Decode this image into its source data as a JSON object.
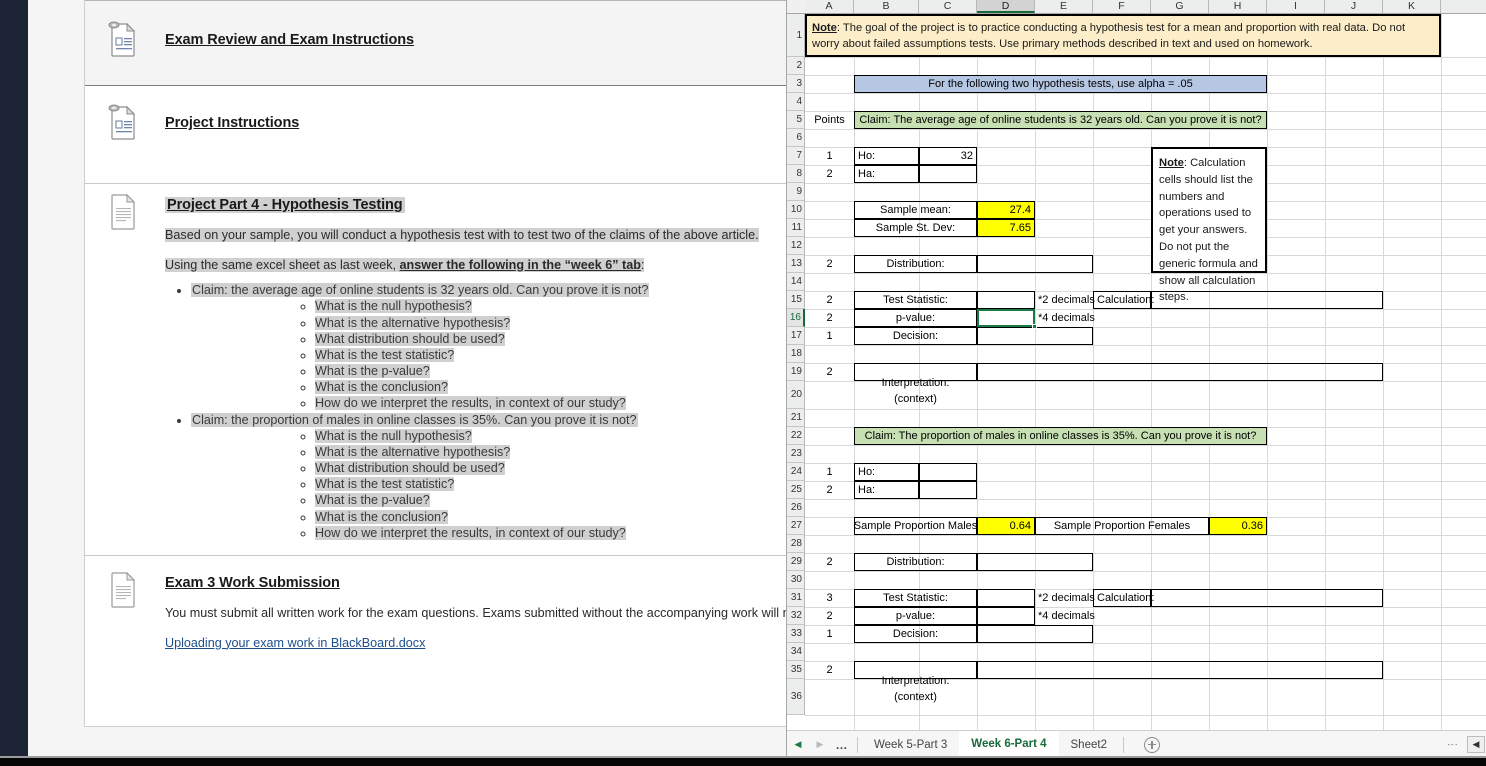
{
  "lms": {
    "items": [
      {
        "id": "exam-review",
        "icon": "document-attachment-icon",
        "title": "Exam Review and Exam Instructions",
        "selected": true
      },
      {
        "id": "project-instructions",
        "icon": "document-attachment-icon",
        "title": "Project Instructions",
        "selected": false
      },
      {
        "id": "project-part-4",
        "icon": "document-icon",
        "title": "Project Part 4 - Hypothesis Testing",
        "paragraphs": [
          "Based on your sample, you will conduct a hypothesis test with  to test two of the claims of the above article.",
          "Using the same excel sheet as last week, "
        ],
        "paragraph2_bold": "answer the following in the “week 6” tab",
        "paragraph2_tail": ":",
        "bullets": [
          {
            "text": "Claim: the average age of online students is 32 years old. Can you prove it is not?",
            "sub": [
              "What is the null hypothesis?",
              "What is the alternative hypothesis?",
              "What distribution should be used?",
              "What is the test statistic?",
              "What is the p-value?",
              "What is the conclusion?",
              "How do we interpret the results, in context of our study?"
            ]
          },
          {
            "text": "Claim: the proportion of males in online classes is 35%. Can you prove it is not?",
            "sub": [
              "What is the null hypothesis?",
              "What is the alternative hypothesis?",
              "What distribution should be used?",
              "What is the test statistic?",
              "What is the p-value?",
              "What is the conclusion?",
              "How do we interpret the results, in context of our study?"
            ]
          }
        ]
      },
      {
        "id": "exam-3-submission",
        "icon": "document-icon",
        "title": "Exam 3 Work Submission",
        "paragraph": "You must submit all written work for the exam questions. Exams submitted without the accompanying work will not be",
        "link": "Uploading your exam work in BlackBoard.docx"
      }
    ]
  },
  "excel": {
    "columns": [
      "A",
      "B",
      "C",
      "D",
      "E",
      "F",
      "G",
      "H",
      "I",
      "J",
      "K"
    ],
    "selected_column": "D",
    "selected_row": "16",
    "rows": [
      "1",
      "2",
      "3",
      "4",
      "5",
      "6",
      "7",
      "8",
      "9",
      "10",
      "11",
      "12",
      "13",
      "14",
      "15",
      "16",
      "17",
      "18",
      "19",
      "20",
      "21",
      "22",
      "23",
      "24",
      "25",
      "26",
      "27",
      "28",
      "29",
      "30",
      "31",
      "32",
      "33",
      "34",
      "35",
      "36"
    ],
    "colors": {
      "accent_green": "#17693a",
      "highlight_yellow": "#ffff00",
      "claim_banner_green": "#c6dfb3",
      "alpha_banner_blue": "#b6c7e3",
      "note_band_cream": "#fdeeca"
    },
    "cells": {
      "note_band_prefix": "Note",
      "note_band_text": ": The goal of the project is to practice conducting a hypothesis test for a mean and proportion with real data. Do not worry about failed assumptions tests. Use primary methods described in text and used on homework.",
      "alpha_banner": "For the following two hypothesis tests, use alpha = .05",
      "points_header": "Points",
      "claim_1": "Claim: The average age of online students is 32 years old. Can you prove it is not?",
      "claim_2": "Claim: The proportion of males in online classes is 35%. Can you prove it is not?",
      "note_box_prefix": "Note",
      "note_box_text": ": Calculation cells should list the numbers and operations used to get your answers. Do not put the generic formula and show all calculation steps.",
      "ho_label": "Ho:",
      "ha_label": "Ha:",
      "ho_value_1": "32",
      "sample_mean_label": "Sample mean:",
      "sample_mean_value": "27.4",
      "sample_sd_label": "Sample St. Dev:",
      "sample_sd_value": "7.65",
      "distribution_label": "Distribution:",
      "test_statistic_label": "Test Statistic:",
      "pvalue_label": "p-value:",
      "decision_label": "Decision:",
      "two_decimals": "*2 decimals",
      "four_decimals": "*4 decimals",
      "calculation_label": "Calculation:",
      "interpretation_label": "Interpretation:",
      "interpretation_sub": "(context)",
      "sample_prop_males_label": "Sample Proportion Males",
      "sample_prop_males_value": "0.64",
      "sample_prop_females_label": "Sample Proportion Females",
      "sample_prop_females_value": "0.36",
      "points": {
        "r7": "1",
        "r8": "2",
        "r13": "2",
        "r15": "2",
        "r16": "2",
        "r17": "1",
        "r19": "2",
        "r24": "1",
        "r25": "2",
        "r29": "2",
        "r31": "3",
        "r32": "2",
        "r33": "1",
        "r35": "2"
      }
    },
    "tabs": [
      {
        "label": "Week 5-Part 3",
        "active": false
      },
      {
        "label": "Week 6-Part 4",
        "active": true
      },
      {
        "label": "Sheet2",
        "active": false
      }
    ],
    "tab_nav": {
      "prev": "◀",
      "next": "▶",
      "dots": "…",
      "add": "add-sheet"
    }
  }
}
